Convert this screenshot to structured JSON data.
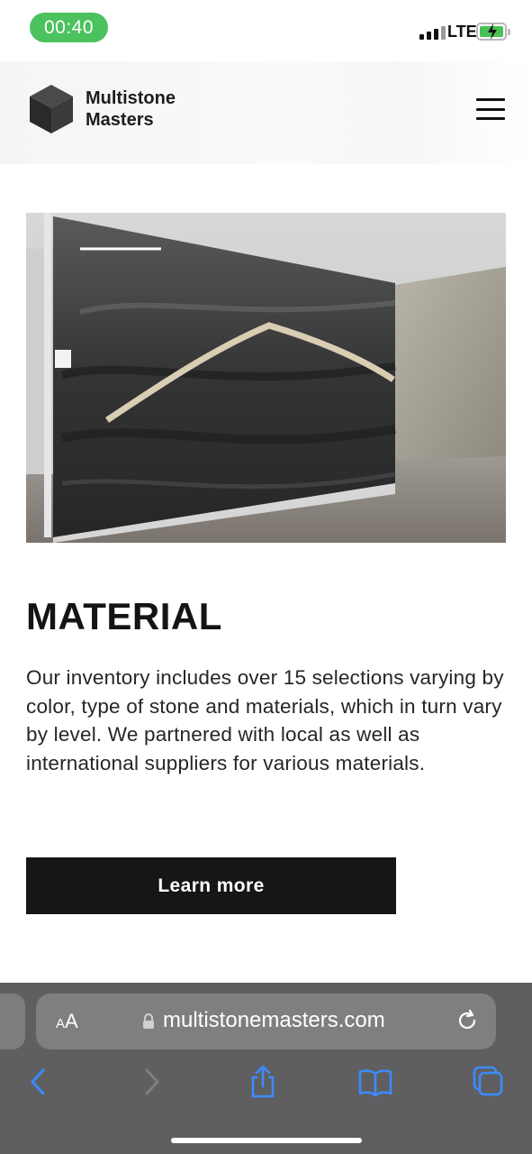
{
  "status_bar": {
    "time": "00:40",
    "network": "LTE",
    "colors": {
      "time_pill": "#4cc25f",
      "battery": "#48c254"
    }
  },
  "header": {
    "brand_line1": "Multistone",
    "brand_line2": "Masters",
    "menu_icon": "hamburger-icon"
  },
  "hero_image": {
    "description_icon": "stone-slab-photo"
  },
  "content": {
    "title": "MATERIAL",
    "body": "Our inventory includes over 15 selections varying by color, type of stone and materials, which in turn vary by level. We partnered with local as well as international suppliers for various materials.",
    "cta_label": "Learn more"
  },
  "browser": {
    "text_size_label": "AA",
    "url": "multistonemasters.com",
    "toolbar_icons": [
      "back-icon",
      "forward-icon",
      "share-icon",
      "bookmarks-icon",
      "tabs-icon"
    ],
    "accent": "#3b8cff"
  }
}
